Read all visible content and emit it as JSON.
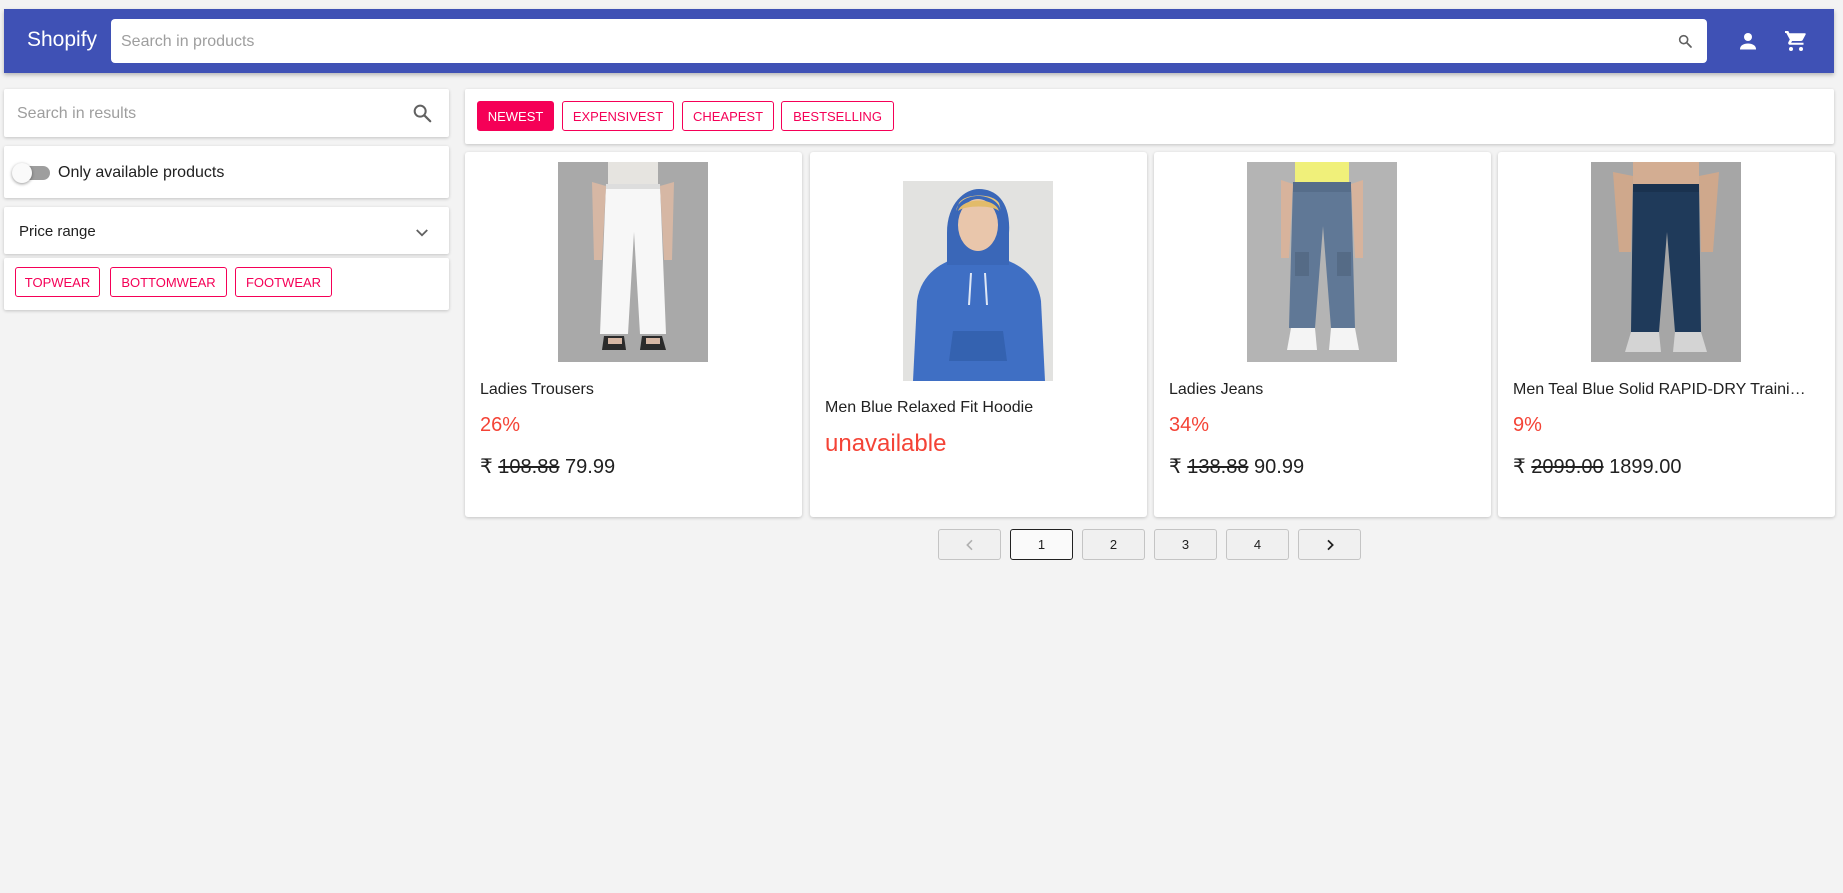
{
  "header": {
    "brand": "Shopify",
    "search_placeholder": "Search in products",
    "icons": [
      "search-icon",
      "account-icon",
      "cart-icon"
    ]
  },
  "sidebar": {
    "search_placeholder": "Search in results",
    "only_available_label": "Only available products",
    "only_available_on": false,
    "price_range_label": "Price range",
    "categories": [
      "TOPWEAR",
      "BOTTOMWEAR",
      "FOOTWEAR"
    ]
  },
  "sort": {
    "options": [
      "NEWEST",
      "EXPENSIVEST",
      "CHEAPEST",
      "BESTSELLING"
    ],
    "selected": "NEWEST"
  },
  "products": [
    {
      "name": "Ladies Trousers",
      "discount": "26%",
      "currency": "₹",
      "old_price": "108.88",
      "price": "79.99",
      "image": "white-trousers-photo"
    },
    {
      "name": "Men Blue Relaxed Fit Hoodie",
      "status": "unavailable",
      "image": "blue-hoodie-photo"
    },
    {
      "name": "Ladies Jeans",
      "discount": "34%",
      "currency": "₹",
      "old_price": "138.88",
      "price": "90.99",
      "image": "grey-jeans-photo"
    },
    {
      "name": "Men Teal Blue Solid RAPID-DRY Traini…",
      "discount": "9%",
      "currency": "₹",
      "old_price": "2099.00",
      "price": "1899.00",
      "image": "navy-joggers-photo"
    }
  ],
  "pagination": {
    "pages": [
      "1",
      "2",
      "3",
      "4"
    ],
    "current": "1"
  },
  "colors": {
    "primary": "#3f51b5",
    "accent": "#f50057",
    "error": "#f44336",
    "background": "#f3f3f3"
  }
}
